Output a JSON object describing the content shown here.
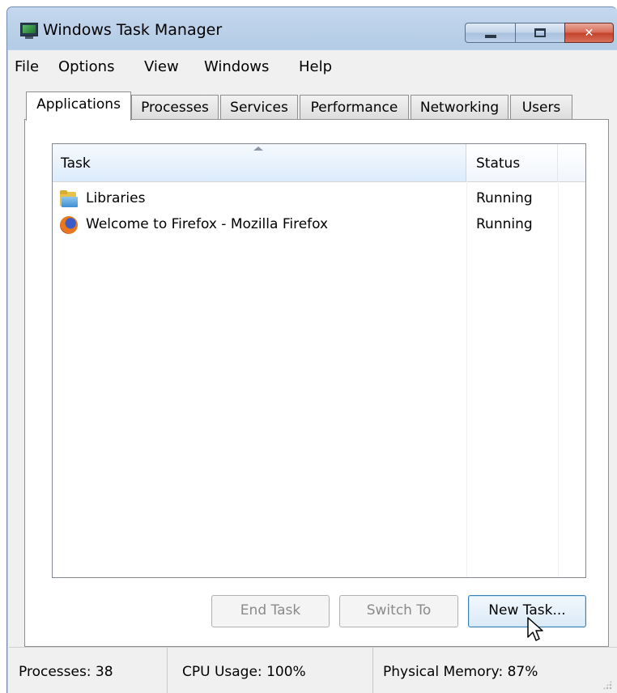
{
  "window": {
    "title": "Windows Task Manager",
    "icon": "task-manager-monitor-icon",
    "controls": {
      "minimize": "minimize-icon",
      "maximize": "maximize-icon",
      "close": "✕"
    }
  },
  "menu": {
    "items": [
      "File",
      "Options",
      "View",
      "Windows",
      "Help"
    ]
  },
  "tabs": [
    {
      "label": "Applications",
      "active": true
    },
    {
      "label": "Processes",
      "active": false
    },
    {
      "label": "Services",
      "active": false
    },
    {
      "label": "Performance",
      "active": false
    },
    {
      "label": "Networking",
      "active": false
    },
    {
      "label": "Users",
      "active": false
    }
  ],
  "list": {
    "columns": {
      "task": "Task",
      "status": "Status"
    },
    "sort": "task-ascending",
    "rows": [
      {
        "task": "Libraries",
        "status": "Running",
        "icon": "folder-libraries-icon"
      },
      {
        "task": "Welcome to Firefox - Mozilla Firefox",
        "status": "Running",
        "icon": "firefox-icon"
      }
    ]
  },
  "buttons": {
    "end_task": "End Task",
    "switch_to": "Switch To",
    "new_task": "New Task..."
  },
  "status": {
    "processes": "Processes: 38",
    "cpu": "CPU Usage: 100%",
    "memory": "Physical Memory: 87%"
  },
  "colors": {
    "title_bar": "#b9d1ea",
    "close_button": "#c94a34",
    "header_highlight": "#dcebfc"
  }
}
